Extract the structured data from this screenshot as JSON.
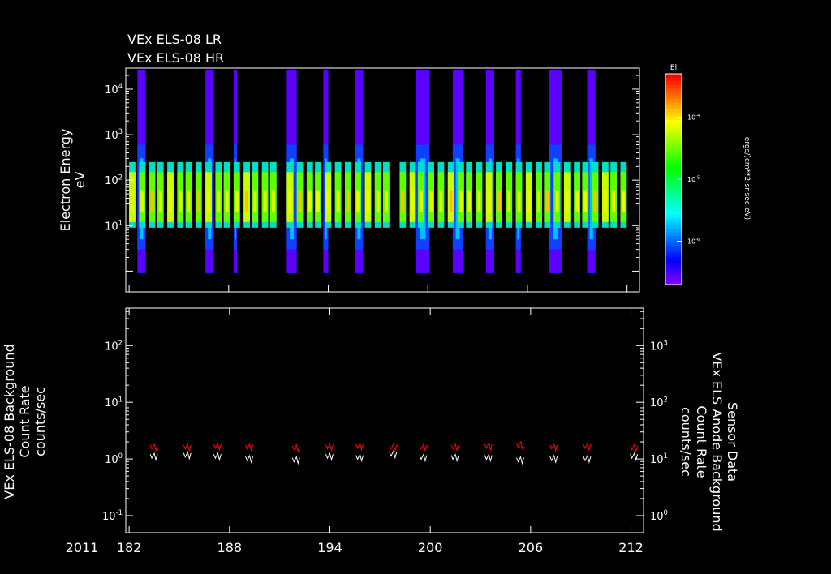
{
  "chart_data": [
    {
      "type": "heatmap",
      "title_lines": [
        "VEx ELS-08 LR",
        "VEx ELS-08 HR"
      ],
      "ylabel": "Electron Energy",
      "yunits": "eV",
      "yscale": "log",
      "ylim": [
        0.35,
        29000
      ],
      "yticks": [
        {
          "v": 1,
          "label": ""
        },
        {
          "v": 10,
          "label": "10",
          "exp": "1"
        },
        {
          "v": 100,
          "label": "10",
          "exp": "2"
        },
        {
          "v": 1000,
          "label": "10",
          "exp": "3"
        },
        {
          "v": 10000,
          "label": "10",
          "exp": "4"
        }
      ],
      "xlim": [
        181.8,
        212.75
      ],
      "highE_columns": [
        [
          182.5,
          183.0
        ],
        [
          186.6,
          187.1
        ],
        [
          188.3,
          188.5
        ],
        [
          191.5,
          192.1
        ],
        [
          193.7,
          194.0
        ],
        [
          195.6,
          196.1
        ],
        [
          199.3,
          200.1
        ],
        [
          201.5,
          202.1
        ],
        [
          203.5,
          204.0
        ],
        [
          205.3,
          205.6
        ],
        [
          207.3,
          208.1
        ],
        [
          209.6,
          210.1
        ]
      ],
      "band_starts": [
        182.0,
        182.6,
        183.2,
        183.7,
        184.3,
        184.9,
        185.4,
        186.0,
        186.6,
        187.2,
        187.7,
        188.3,
        188.9,
        189.4,
        190.0,
        190.5,
        191.5,
        192.1,
        192.7,
        193.2,
        193.8,
        194.4,
        195.0,
        195.6,
        196.2,
        196.8,
        197.3,
        198.3,
        198.9,
        199.4,
        200.0,
        200.6,
        201.2,
        201.8,
        202.3,
        202.9,
        203.5,
        204.1,
        204.7,
        205.3,
        205.9,
        206.5,
        207.0,
        207.6,
        208.2,
        208.8,
        209.3,
        209.9,
        210.5,
        211.0,
        211.6
      ],
      "band_range_eV": [
        9,
        250
      ],
      "colorbar": {
        "title": "El",
        "units": "ergs/(cm**2-sr-sec-eV)",
        "scale": "log",
        "range": [
          2e-07,
          0.0005
        ],
        "ticks": [
          {
            "v": 0.0001,
            "label": "10",
            "exp": "-4"
          },
          {
            "v": 1e-05,
            "label": "10",
            "exp": "-5"
          },
          {
            "v": 1e-06,
            "label": "10",
            "exp": "-6"
          }
        ]
      }
    },
    {
      "type": "line",
      "ylabel_lines": [
        "Sensor Data",
        "VEx ELS-08 Background",
        "Count Rate",
        "counts/sec"
      ],
      "ylabel_right_lines": [
        "Sensor Data",
        "VEx ELS Anode Background",
        "Count Rate",
        "counts/sec"
      ],
      "yscale": "log",
      "ylim": [
        0.05,
        460
      ],
      "yticks": [
        {
          "v": 0.1,
          "label": "10",
          "exp": "-1"
        },
        {
          "v": 1,
          "label": "10",
          "exp": "0"
        },
        {
          "v": 10,
          "label": "10",
          "exp": "1"
        },
        {
          "v": 100,
          "label": "10",
          "exp": "2"
        }
      ],
      "yticks_right": [
        {
          "v": 0.1,
          "label": "10",
          "exp": "0"
        },
        {
          "v": 1,
          "label": "10",
          "exp": "1"
        },
        {
          "v": 10,
          "label": "10",
          "exp": "2"
        },
        {
          "v": 100,
          "label": "10",
          "exp": "3"
        }
      ],
      "xlabel_year": "2011",
      "xticks": [
        182,
        188,
        194,
        200,
        206,
        212
      ],
      "series": [
        {
          "name": "ELS-08 Background",
          "color": "#ffffff",
          "days": [
            183.5,
            185.5,
            187.3,
            189.2,
            192.0,
            194.0,
            195.8,
            197.8,
            199.6,
            201.5,
            203.5,
            205.4,
            207.4,
            209.4,
            212.2
          ],
          "values": [
            1.1,
            1.15,
            1.1,
            1.0,
            0.95,
            1.1,
            1.05,
            1.2,
            1.05,
            1.05,
            1.05,
            0.95,
            1.0,
            1.0,
            1.1
          ]
        },
        {
          "name": "Anode Background",
          "color": "#ff0000",
          "days": [
            183.5,
            185.5,
            187.3,
            189.2,
            192.0,
            194.0,
            195.8,
            197.8,
            199.6,
            201.5,
            203.5,
            205.4,
            207.4,
            209.4,
            212.2
          ],
          "values": [
            1.6,
            1.6,
            1.65,
            1.6,
            1.55,
            1.6,
            1.65,
            1.6,
            1.6,
            1.6,
            1.65,
            1.75,
            1.6,
            1.65,
            1.55
          ]
        }
      ]
    }
  ]
}
